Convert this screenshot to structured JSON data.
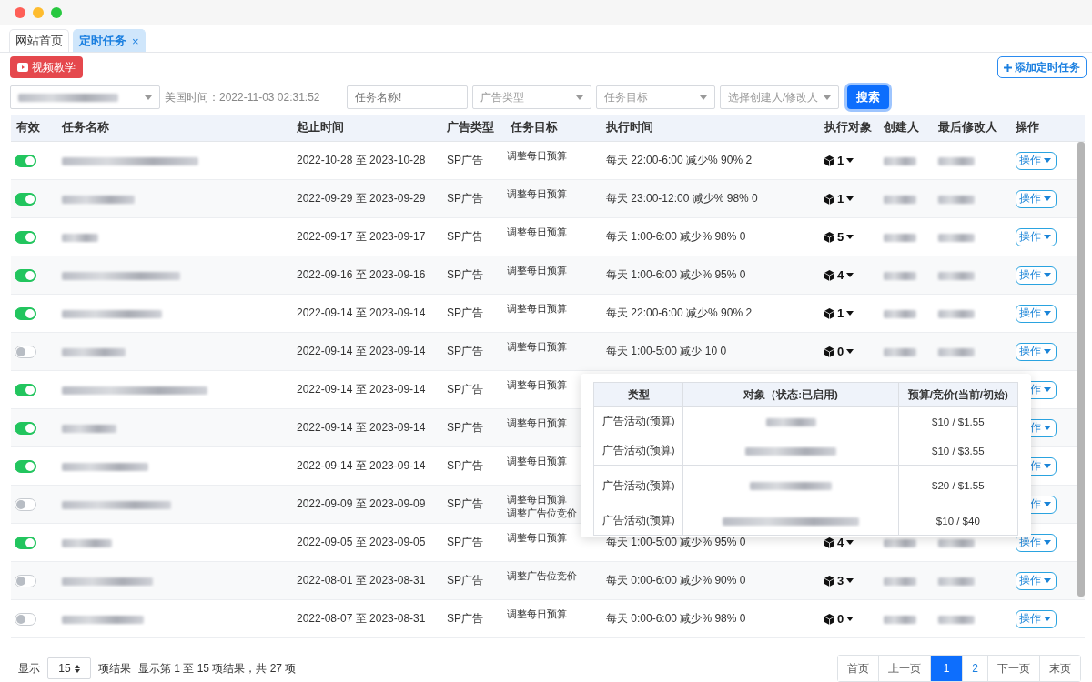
{
  "tabs": [
    {
      "label": "网站首页",
      "selected": false
    },
    {
      "label": "定时任务",
      "selected": true,
      "close": "×"
    }
  ],
  "toolbar": {
    "video_button": "视频教学",
    "add_button": "添加定时任务"
  },
  "filters": {
    "time_label": "美国时间：2022-11-03 02:31:52",
    "name_placeholder": "任务名称!",
    "ad_type_placeholder": "广告类型",
    "goal_placeholder": "任务目标",
    "user_placeholder": "选择创建人/修改人",
    "search_button": "搜索"
  },
  "table": {
    "columns": [
      "有效",
      "任务名称",
      "起止时间",
      "广告类型",
      "任务目标",
      "执行时间",
      "执行对象",
      "创建人",
      "最后修改人",
      "操作"
    ],
    "rows": [
      {
        "enabled": true,
        "dates": "2022-10-28 至 2023-10-28",
        "ad_type": "SP广告",
        "goals": [
          "调整每日预算"
        ],
        "exec_time": "每天 22:00-6:00 减少% 90% 2",
        "target": "1",
        "action": "操作"
      },
      {
        "enabled": true,
        "dates": "2022-09-29 至 2023-09-29",
        "ad_type": "SP广告",
        "goals": [
          "调整每日预算"
        ],
        "exec_time": "每天 23:00-12:00 减少% 98% 0",
        "target": "1",
        "action": "操作"
      },
      {
        "enabled": true,
        "dates": "2022-09-17 至 2023-09-17",
        "ad_type": "SP广告",
        "goals": [
          "调整每日预算"
        ],
        "exec_time": "每天 1:00-6:00 减少% 98% 0",
        "target": "5",
        "action": "操作"
      },
      {
        "enabled": true,
        "dates": "2022-09-16 至 2023-09-16",
        "ad_type": "SP广告",
        "goals": [
          "调整每日预算"
        ],
        "exec_time": "每天 1:00-6:00 减少% 95% 0",
        "target": "4",
        "action": "操作"
      },
      {
        "enabled": true,
        "dates": "2022-09-14 至 2023-09-14",
        "ad_type": "SP广告",
        "goals": [
          "调整每日预算"
        ],
        "exec_time": "每天 22:00-6:00 减少% 90% 2",
        "target": "1",
        "action": "操作"
      },
      {
        "enabled": false,
        "dates": "2022-09-14 至 2023-09-14",
        "ad_type": "SP广告",
        "goals": [
          "调整每日预算"
        ],
        "exec_time": "每天 1:00-5:00 减少 10 0",
        "target": "0",
        "action": "操作"
      },
      {
        "enabled": true,
        "dates": "2022-09-14 至 2023-09-14",
        "ad_type": "SP广告",
        "goals": [
          "调整每日预算"
        ],
        "action": "作"
      },
      {
        "enabled": true,
        "dates": "2022-09-14 至 2023-09-14",
        "ad_type": "SP广告",
        "goals": [
          "调整每日预算"
        ],
        "action": "作"
      },
      {
        "enabled": true,
        "dates": "2022-09-14 至 2023-09-14",
        "ad_type": "SP广告",
        "goals": [
          "调整每日预算"
        ],
        "action": "作"
      },
      {
        "enabled": false,
        "dates": "2022-09-09 至 2023-09-09",
        "ad_type": "SP广告",
        "goals": [
          "调整每日预算",
          "调整广告位竞价"
        ],
        "action": "作"
      },
      {
        "enabled": true,
        "dates": "2022-09-05 至 2023-09-05",
        "ad_type": "SP广告",
        "goals": [
          "调整每日预算"
        ],
        "exec_time": "每天 1:00-5:00 减少% 95% 0",
        "target": "4",
        "action": "操作"
      },
      {
        "enabled": false,
        "dates": "2022-08-01 至 2023-08-31",
        "ad_type": "SP广告",
        "goals": [
          "调整广告位竞价"
        ],
        "exec_time": "每天 0:00-6:00 减少% 90% 0",
        "target": "3",
        "action": "操作"
      },
      {
        "enabled": false,
        "dates": "2022-08-07 至 2023-08-31",
        "ad_type": "SP广告",
        "goals": [
          "调整每日预算"
        ],
        "exec_time": "每天 0:00-6:00 减少% 98% 0",
        "target": "0",
        "action": "操作"
      }
    ]
  },
  "popup": {
    "columns": [
      "类型",
      "对象（状态:已启用)",
      "预算/竞价(当前/初始)"
    ],
    "rows": [
      {
        "type": "广告活动(预算)",
        "budget": "$10 / $1.55"
      },
      {
        "type": "广告活动(预算)",
        "budget": "$10 / $3.55"
      },
      {
        "type": "广告活动(预算)",
        "budget": "$20 / $1.55"
      },
      {
        "type": "广告活动(预算)",
        "budget": "$10 / $40"
      }
    ]
  },
  "footer": {
    "show_label": "显示",
    "page_size": "15",
    "unit_label": "项结果",
    "summary": "显示第 1 至 15 项结果，共 27 项"
  },
  "pagination": [
    {
      "label": "首页",
      "selected": false
    },
    {
      "label": "上一页",
      "selected": false
    },
    {
      "label": "1",
      "selected": true
    },
    {
      "label": "2",
      "selected": false
    },
    {
      "label": "下一页",
      "selected": false
    },
    {
      "label": "末页",
      "selected": false
    }
  ]
}
